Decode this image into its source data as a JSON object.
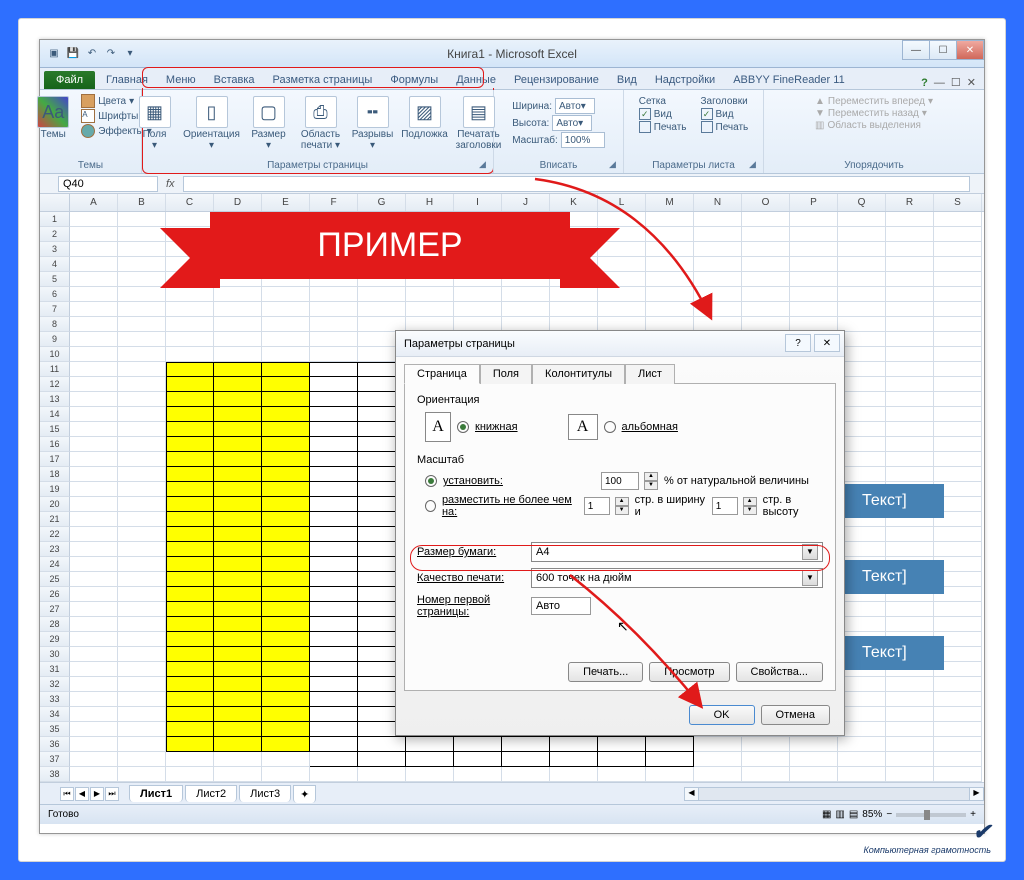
{
  "window": {
    "title": "Книга1 - Microsoft Excel"
  },
  "tabs": {
    "file": "Файл",
    "items": [
      "Главная",
      "Меню",
      "Вставка",
      "Разметка страницы",
      "Формулы",
      "Данные",
      "Рецензирование",
      "Вид",
      "Надстройки",
      "ABBYY FineReader 11"
    ]
  },
  "ribbon": {
    "themes_group": "Темы",
    "themes": "Темы",
    "colors": "Цвета",
    "fonts": "Шрифты",
    "effects": "Эффекты",
    "page_setup_group": "Параметры страницы",
    "margins": "Поля",
    "orientation": "Ориентация",
    "size": "Размер",
    "print_area": "Область печати",
    "breaks": "Разрывы",
    "background": "Подложка",
    "print_titles": "Печатать заголовки",
    "fit_group": "Вписать",
    "width_lbl": "Ширина:",
    "height_lbl": "Высота:",
    "scale_lbl": "Масштаб:",
    "auto": "Авто",
    "scale_val": "100%",
    "sheet_options_group": "Параметры листа",
    "grid_lbl": "Сетка",
    "headings_lbl": "Заголовки",
    "view_chk": "Вид",
    "print_chk": "Печать",
    "arrange_group": "Упорядочить",
    "bring_fwd": "Переместить вперед",
    "send_back": "Переместить назад",
    "selection_pane": "Область выделения"
  },
  "namebox": "Q40",
  "columns": [
    "A",
    "B",
    "C",
    "D",
    "E",
    "F",
    "G",
    "H",
    "I",
    "J",
    "K",
    "L",
    "M",
    "N",
    "O",
    "P",
    "Q",
    "R",
    "S"
  ],
  "banner_text": "ПРИМЕР",
  "text_box": "Текст]",
  "sheets": {
    "s1": "Лист1",
    "s2": "Лист2",
    "s3": "Лист3"
  },
  "status": {
    "ready": "Готово",
    "zoom": "85%"
  },
  "dialog": {
    "title": "Параметры страницы",
    "tabs": [
      "Страница",
      "Поля",
      "Колонтитулы",
      "Лист"
    ],
    "orientation_lbl": "Ориентация",
    "portrait": "книжная",
    "landscape": "альбомная",
    "scale_lbl": "Масштаб",
    "adjust_to": "установить:",
    "adjust_val": "100",
    "adjust_suffix": "% от натуральной величины",
    "fit_to": "разместить не более чем на:",
    "fit_w": "1",
    "fit_w_suffix": "стр. в ширину и",
    "fit_h": "1",
    "fit_h_suffix": "стр. в высоту",
    "paper_size_lbl": "Размер бумаги:",
    "paper_size": "A4",
    "print_quality_lbl": "Качество печати:",
    "print_quality": "600 точек на дюйм",
    "first_page_lbl": "Номер первой страницы:",
    "first_page": "Авто",
    "print_btn": "Печать...",
    "preview_btn": "Просмотр",
    "options_btn": "Свойства...",
    "ok": "OK",
    "cancel": "Отмена"
  },
  "watermark": "Компьютерная грамотность"
}
